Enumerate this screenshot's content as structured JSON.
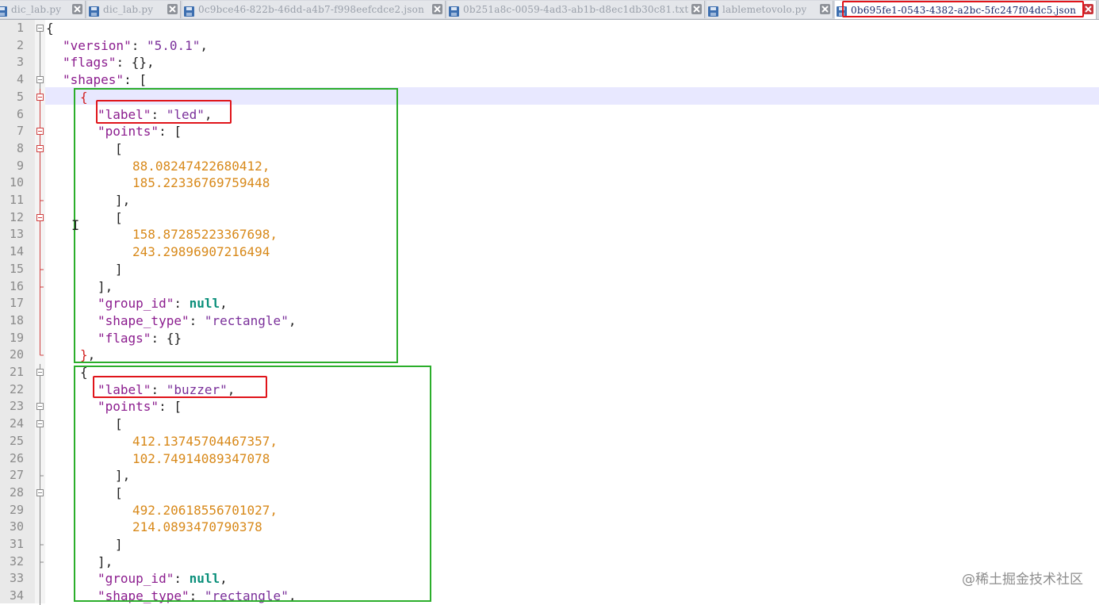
{
  "tabs": [
    {
      "label": "dic_lab.py"
    },
    {
      "label": "dic_lab.py"
    },
    {
      "label": "0c9bce46-822b-46dd-a4b7-f998eefcdce2.json"
    },
    {
      "label": "0b251a8c-0059-4ad3-ab1b-d8ec1db30c81.txt"
    },
    {
      "label": "lablemetovolo.py"
    },
    {
      "label": "0b695fe1-0543-4382-a2bc-5fc247f04dc5.json"
    }
  ],
  "line_numbers": [
    "1",
    "2",
    "3",
    "4",
    "5",
    "6",
    "7",
    "8",
    "9",
    "10",
    "11",
    "12",
    "13",
    "14",
    "15",
    "16",
    "17",
    "18",
    "19",
    "20",
    "21",
    "22",
    "23",
    "24",
    "25",
    "26",
    "27",
    "28",
    "29",
    "30",
    "31",
    "32",
    "33",
    "34"
  ],
  "code": {
    "l1": "{",
    "l2": {
      "key": "\"version\"",
      "sep": ": ",
      "val": "\"5.0.1\"",
      "end": ","
    },
    "l3": {
      "key": "\"flags\"",
      "rest": ": {},"
    },
    "l4": {
      "key": "\"shapes\"",
      "rest": ": ["
    },
    "l5": "{",
    "l6": {
      "key": "\"label\"",
      "sep": ": ",
      "val": "\"led\"",
      "end": ","
    },
    "l7": {
      "key": "\"points\"",
      "rest": ": ["
    },
    "l8": "[",
    "l9": "88.08247422680412,",
    "l10": "185.22336769759448",
    "l11": "],",
    "l12": "[",
    "l13": "158.87285223367698,",
    "l14": "243.29896907216494",
    "l15": "]",
    "l16": "],",
    "l17": {
      "key": "\"group_id\"",
      "sep": ": ",
      "kw": "null",
      "end": ","
    },
    "l18": {
      "key": "\"shape_type\"",
      "sep": ": ",
      "val": "\"rectangle\"",
      "end": ","
    },
    "l19": {
      "key": "\"flags\"",
      "rest": ": {}"
    },
    "l20": {
      "brace": "}",
      "end": ","
    },
    "l21": "{",
    "l22": {
      "key": "\"label\"",
      "sep": ": ",
      "val": "\"buzzer\"",
      "end": ","
    },
    "l23": {
      "key": "\"points\"",
      "rest": ": ["
    },
    "l24": "[",
    "l25": "412.13745704467357,",
    "l26": "102.74914089347078",
    "l27": "],",
    "l28": "[",
    "l29": "492.20618556701027,",
    "l30": "214.0893470790378",
    "l31": "]",
    "l32": "],",
    "l33": {
      "key": "\"group_id\"",
      "sep": ": ",
      "kw": "null",
      "end": ","
    },
    "l34": {
      "key": "\"shape_type\"",
      "sep": ": ",
      "val": "\"rectangle\"",
      "end": ","
    }
  },
  "watermark": "@稀土掘金技术社区",
  "colors": {
    "key": "#8b1c8e",
    "number": "#d8891a",
    "keyword": "#0a8f7a",
    "highlight_box_green": "#2bae2b",
    "highlight_box_red": "#e0141a"
  }
}
